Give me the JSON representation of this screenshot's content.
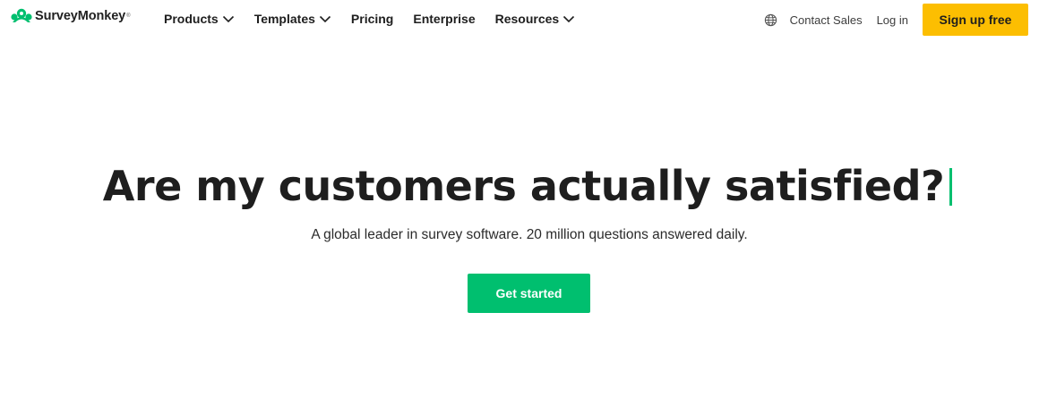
{
  "brand": {
    "name": "SurveyMonkey",
    "trademark": "®",
    "logo_icon": "surveymonkey-logo-icon",
    "color": "#00bf6f"
  },
  "nav": {
    "items": [
      {
        "label": "Products",
        "has_dropdown": true
      },
      {
        "label": "Templates",
        "has_dropdown": true
      },
      {
        "label": "Pricing",
        "has_dropdown": false
      },
      {
        "label": "Enterprise",
        "has_dropdown": false
      },
      {
        "label": "Resources",
        "has_dropdown": true
      }
    ]
  },
  "header_right": {
    "globe_icon": "globe-icon",
    "contact_sales": "Contact Sales",
    "login": "Log in",
    "signup": "Sign up free",
    "signup_color": "#fcbe01"
  },
  "hero": {
    "title": "Are my customers actually satisfied?",
    "subtitle": "A global leader in survey software. 20 million questions answered daily.",
    "cta": "Get started",
    "cta_color": "#00bf6f"
  }
}
